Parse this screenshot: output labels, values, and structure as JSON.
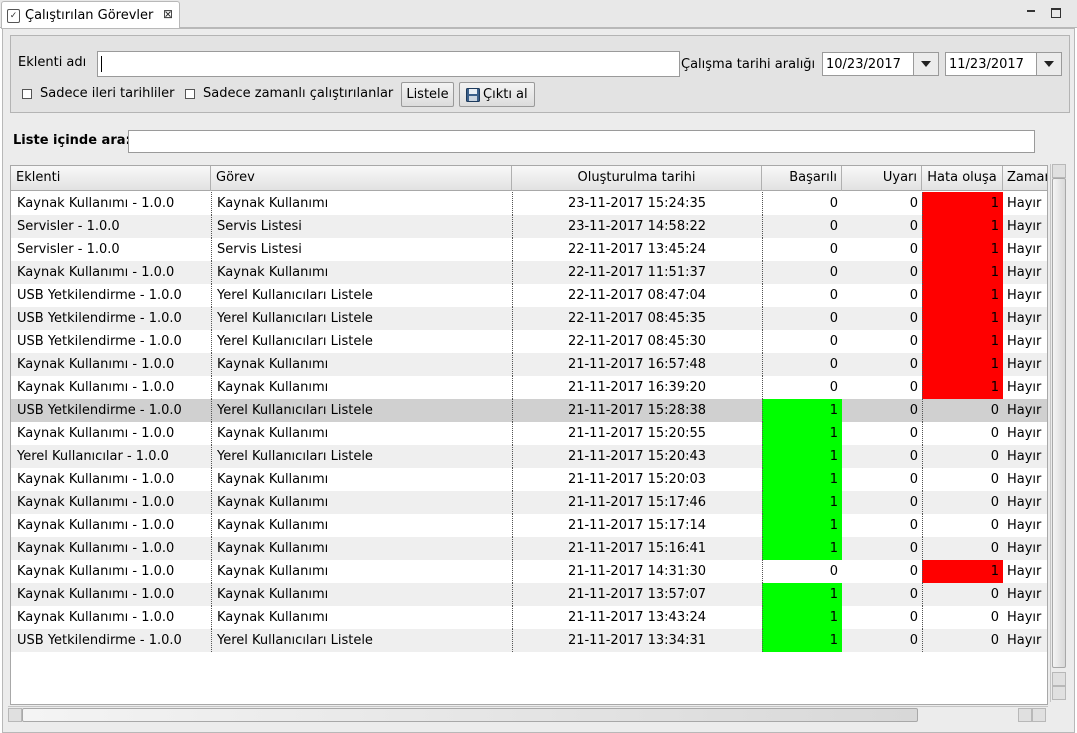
{
  "tab": {
    "title": "Çalıştırılan Görevler",
    "icon": "clipboard-check-icon",
    "close_icon": "close-icon"
  },
  "window_controls": {
    "minimize_icon": "minimize-icon",
    "maximize_icon": "maximize-icon"
  },
  "filters": {
    "plugin_name_label": "Eklenti adı",
    "plugin_name_value": "",
    "date_range_label": "Çalışma tarihi aralığı",
    "date_from": "10/23/2017",
    "date_to": "11/23/2017",
    "future_only_label": "Sadece ileri tarihliler",
    "future_only_checked": false,
    "scheduled_only_label": "Sadece zamanlı çalıştırılanlar",
    "scheduled_only_checked": false,
    "list_button": "Listele",
    "export_button": "Çıktı al",
    "export_icon": "floppy-disk-icon"
  },
  "search": {
    "label": "Liste içinde ara:",
    "value": ""
  },
  "table": {
    "columns": [
      "Eklenti",
      "Görev",
      "Oluşturulma tarihi",
      "Başarılı",
      "Uyarı",
      "Hata oluşa",
      "Zaman"
    ],
    "colors": {
      "success": "#00ff00",
      "error": "#ff0000",
      "selected": "#d0d0d0",
      "alt_row": "#efefef"
    },
    "rows": [
      {
        "plugin": "Kaynak Kullanımı - 1.0.0",
        "task": "Kaynak Kullanımı",
        "created": "23-11-2017 15:24:35",
        "success": "0",
        "warning": "0",
        "error": "1",
        "scheduled": "Hayır"
      },
      {
        "plugin": "Servisler - 1.0.0",
        "task": "Servis Listesi",
        "created": "23-11-2017 14:58:22",
        "success": "0",
        "warning": "0",
        "error": "1",
        "scheduled": "Hayır"
      },
      {
        "plugin": "Servisler - 1.0.0",
        "task": "Servis Listesi",
        "created": "22-11-2017 13:45:24",
        "success": "0",
        "warning": "0",
        "error": "1",
        "scheduled": "Hayır"
      },
      {
        "plugin": "Kaynak Kullanımı - 1.0.0",
        "task": "Kaynak Kullanımı",
        "created": "22-11-2017 11:51:37",
        "success": "0",
        "warning": "0",
        "error": "1",
        "scheduled": "Hayır"
      },
      {
        "plugin": "USB Yetkilendirme - 1.0.0",
        "task": "Yerel Kullanıcıları Listele",
        "created": "22-11-2017 08:47:04",
        "success": "0",
        "warning": "0",
        "error": "1",
        "scheduled": "Hayır"
      },
      {
        "plugin": "USB Yetkilendirme - 1.0.0",
        "task": "Yerel Kullanıcıları Listele",
        "created": "22-11-2017 08:45:35",
        "success": "0",
        "warning": "0",
        "error": "1",
        "scheduled": "Hayır"
      },
      {
        "plugin": "USB Yetkilendirme - 1.0.0",
        "task": "Yerel Kullanıcıları Listele",
        "created": "22-11-2017 08:45:30",
        "success": "0",
        "warning": "0",
        "error": "1",
        "scheduled": "Hayır"
      },
      {
        "plugin": "Kaynak Kullanımı - 1.0.0",
        "task": "Kaynak Kullanımı",
        "created": "21-11-2017 16:57:48",
        "success": "0",
        "warning": "0",
        "error": "1",
        "scheduled": "Hayır"
      },
      {
        "plugin": "Kaynak Kullanımı - 1.0.0",
        "task": "Kaynak Kullanımı",
        "created": "21-11-2017 16:39:20",
        "success": "0",
        "warning": "0",
        "error": "1",
        "scheduled": "Hayır"
      },
      {
        "plugin": "USB Yetkilendirme - 1.0.0",
        "task": "Yerel Kullanıcıları Listele",
        "created": "21-11-2017 15:28:38",
        "success": "1",
        "warning": "0",
        "error": "0",
        "scheduled": "Hayır",
        "selected": true
      },
      {
        "plugin": "Kaynak Kullanımı - 1.0.0",
        "task": "Kaynak Kullanımı",
        "created": "21-11-2017 15:20:55",
        "success": "1",
        "warning": "0",
        "error": "0",
        "scheduled": "Hayır"
      },
      {
        "plugin": "Yerel Kullanıcılar - 1.0.0",
        "task": "Yerel Kullanıcıları Listele",
        "created": "21-11-2017 15:20:43",
        "success": "1",
        "warning": "0",
        "error": "0",
        "scheduled": "Hayır"
      },
      {
        "plugin": "Kaynak Kullanımı - 1.0.0",
        "task": "Kaynak Kullanımı",
        "created": "21-11-2017 15:20:03",
        "success": "1",
        "warning": "0",
        "error": "0",
        "scheduled": "Hayır"
      },
      {
        "plugin": "Kaynak Kullanımı - 1.0.0",
        "task": "Kaynak Kullanımı",
        "created": "21-11-2017 15:17:46",
        "success": "1",
        "warning": "0",
        "error": "0",
        "scheduled": "Hayır"
      },
      {
        "plugin": "Kaynak Kullanımı - 1.0.0",
        "task": "Kaynak Kullanımı",
        "created": "21-11-2017 15:17:14",
        "success": "1",
        "warning": "0",
        "error": "0",
        "scheduled": "Hayır"
      },
      {
        "plugin": "Kaynak Kullanımı - 1.0.0",
        "task": "Kaynak Kullanımı",
        "created": "21-11-2017 15:16:41",
        "success": "1",
        "warning": "0",
        "error": "0",
        "scheduled": "Hayır"
      },
      {
        "plugin": "Kaynak Kullanımı - 1.0.0",
        "task": "Kaynak Kullanımı",
        "created": "21-11-2017 14:31:30",
        "success": "0",
        "warning": "0",
        "error": "1",
        "scheduled": "Hayır"
      },
      {
        "plugin": "Kaynak Kullanımı - 1.0.0",
        "task": "Kaynak Kullanımı",
        "created": "21-11-2017 13:57:07",
        "success": "1",
        "warning": "0",
        "error": "0",
        "scheduled": "Hayır"
      },
      {
        "plugin": "Kaynak Kullanımı - 1.0.0",
        "task": "Kaynak Kullanımı",
        "created": "21-11-2017 13:43:24",
        "success": "1",
        "warning": "0",
        "error": "0",
        "scheduled": "Hayır"
      },
      {
        "plugin": "USB Yetkilendirme - 1.0.0",
        "task": "Yerel Kullanıcıları Listele",
        "created": "21-11-2017 13:34:31",
        "success": "1",
        "warning": "0",
        "error": "0",
        "scheduled": "Hayır"
      }
    ]
  }
}
